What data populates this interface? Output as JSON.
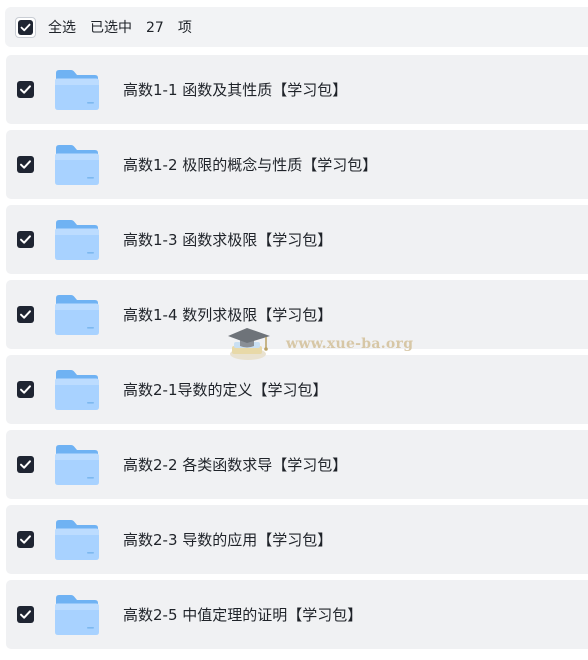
{
  "header": {
    "select_all_label": "全选",
    "selected_prefix": "已选中",
    "selected_count": "27",
    "selected_suffix": "项",
    "checked": true
  },
  "items": [
    {
      "name": "高数1-1 函数及其性质【学习包】",
      "checked": true,
      "icon": "folder-icon"
    },
    {
      "name": "高数1-2 极限的概念与性质【学习包】",
      "checked": true,
      "icon": "folder-icon"
    },
    {
      "name": "高数1-3 函数求极限【学习包】",
      "checked": true,
      "icon": "folder-icon"
    },
    {
      "name": "高数1-4 数列求极限【学习包】",
      "checked": true,
      "icon": "folder-icon"
    },
    {
      "name": "高数2-1导数的定义【学习包】",
      "checked": true,
      "icon": "folder-icon"
    },
    {
      "name": "高数2-2 各类函数求导【学习包】",
      "checked": true,
      "icon": "folder-icon"
    },
    {
      "name": "高数2-3 导数的应用【学习包】",
      "checked": true,
      "icon": "folder-icon"
    },
    {
      "name": "高数2-5 中值定理的证明【学习包】",
      "checked": true,
      "icon": "folder-icon"
    }
  ],
  "watermark": {
    "text": "www.xue-ba.org",
    "icon": "graduation-cap-icon"
  },
  "colors": {
    "checkbox": "#1f2532",
    "row_bg": "#f0f1f3",
    "folder_light": "#a9d3ff",
    "folder_dark": "#7fbcf7"
  }
}
